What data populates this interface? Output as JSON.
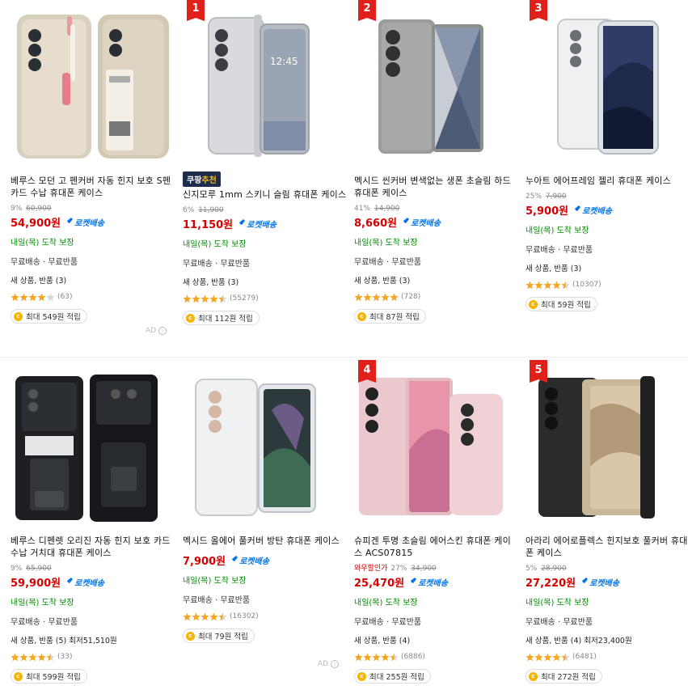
{
  "colors": {
    "price": "#d60000",
    "rocket": "#0074e9",
    "delivery": "#008c00",
    "star": "#f5a623",
    "badge": "#e0201a"
  },
  "rocket_label": "로켓배송",
  "ad_label": "AD",
  "products": [
    {
      "rank": "",
      "coupang_pick": false,
      "title": "베루스 모던 고 펜커버 자동 힌지 보호 S펜 카드 수납 휴대폰 케이스",
      "discount_label": "",
      "discount_pct": "9%",
      "orig_price": "60,900",
      "price": "54,900원",
      "delivery": "내일(목) 도착 보장",
      "shipping": "무료배송 · 무료반품",
      "condition": "새 상품, 반품 (3)",
      "rating": 4,
      "review_count": "(63)",
      "points": "최대 549원 적립",
      "ad": true
    },
    {
      "rank": "1",
      "coupang_pick": true,
      "coupang_badge": [
        "쿠팡",
        "추천"
      ],
      "title": "신지모루 1mm 스키니 슬림 휴대폰 케이스",
      "discount_label": "",
      "discount_pct": "6%",
      "orig_price": "11,900",
      "price": "11,150원",
      "delivery": "내일(목) 도착 보장",
      "shipping": "무료배송 · 무료반품",
      "condition": "새 상품, 반품 (3)",
      "rating": 4.5,
      "review_count": "(55279)",
      "points": "최대 112원 적립",
      "ad": false
    },
    {
      "rank": "2",
      "coupang_pick": false,
      "title": "멕시드 씬커버 변색없는 생폰 초슬림 하드 휴대폰 케이스",
      "discount_label": "",
      "discount_pct": "41%",
      "orig_price": "14,900",
      "price": "8,660원",
      "delivery": "내일(목) 도착 보장",
      "shipping": "무료배송 · 무료반품",
      "condition": "새 상품, 반품 (3)",
      "rating": 5,
      "review_count": "(728)",
      "points": "최대 87원 적립",
      "ad": false
    },
    {
      "rank": "3",
      "coupang_pick": false,
      "title": "누아트 에어프레임 젤리 휴대폰 케이스",
      "discount_label": "",
      "discount_pct": "25%",
      "orig_price": "7,900",
      "price": "5,900원",
      "delivery": "내일(목) 도착 보장",
      "shipping": "무료배송 · 무료반품",
      "condition": "새 상품, 반품 (3)",
      "rating": 4.5,
      "review_count": "(10307)",
      "points": "최대 59원 적립",
      "ad": false
    },
    {
      "rank": "",
      "coupang_pick": false,
      "title": "베루스 디펜렛 오리진 자동 힌지 보호 카드 수납 거치대 휴대폰 케이스",
      "discount_label": "",
      "discount_pct": "9%",
      "orig_price": "65,900",
      "price": "59,900원",
      "delivery": "내일(목) 도착 보장",
      "shipping": "무료배송 · 무료반품",
      "condition": "새 상품, 반품 (5) 최저51,510원",
      "rating": 4.5,
      "review_count": "(33)",
      "points": "최대 599원 적립",
      "ad": false
    },
    {
      "rank": "",
      "coupang_pick": false,
      "title": "멕시드 올에어 풀커버 방탄 휴대폰 케이스",
      "discount_label": "",
      "discount_pct": "",
      "orig_price": "",
      "price": "7,900원",
      "delivery": "내일(목) 도착 보장",
      "shipping": "무료배송 · 무료반품",
      "condition": "",
      "rating": 4.5,
      "review_count": "(16302)",
      "points": "최대 79원 적립",
      "ad": true
    },
    {
      "rank": "4",
      "coupang_pick": false,
      "title": "슈피겐 투명 초슬림 에어스킨 휴대폰 케이스 ACS07815",
      "discount_label": "와우할인가",
      "discount_pct": "27%",
      "orig_price": "34,900",
      "price": "25,470원",
      "delivery": "내일(목) 도착 보장",
      "shipping": "무료배송 · 무료반품",
      "condition": "새 상품, 반품 (4)",
      "rating": 4.5,
      "review_count": "(6886)",
      "points": "최대 255원 적립",
      "ad": false
    },
    {
      "rank": "5",
      "coupang_pick": false,
      "title": "아라리 에어로플렉스 힌지보호 풀커버 휴대폰 케이스",
      "discount_label": "",
      "discount_pct": "5%",
      "orig_price": "28,900",
      "price": "27,220원",
      "delivery": "내일(목) 도착 보장",
      "shipping": "무료배송 · 무료반품",
      "condition": "새 상품, 반품 (4) 최저23,400원",
      "rating": 4.5,
      "review_count": "(6481)",
      "points": "최대 272원 적립",
      "ad": false
    }
  ]
}
